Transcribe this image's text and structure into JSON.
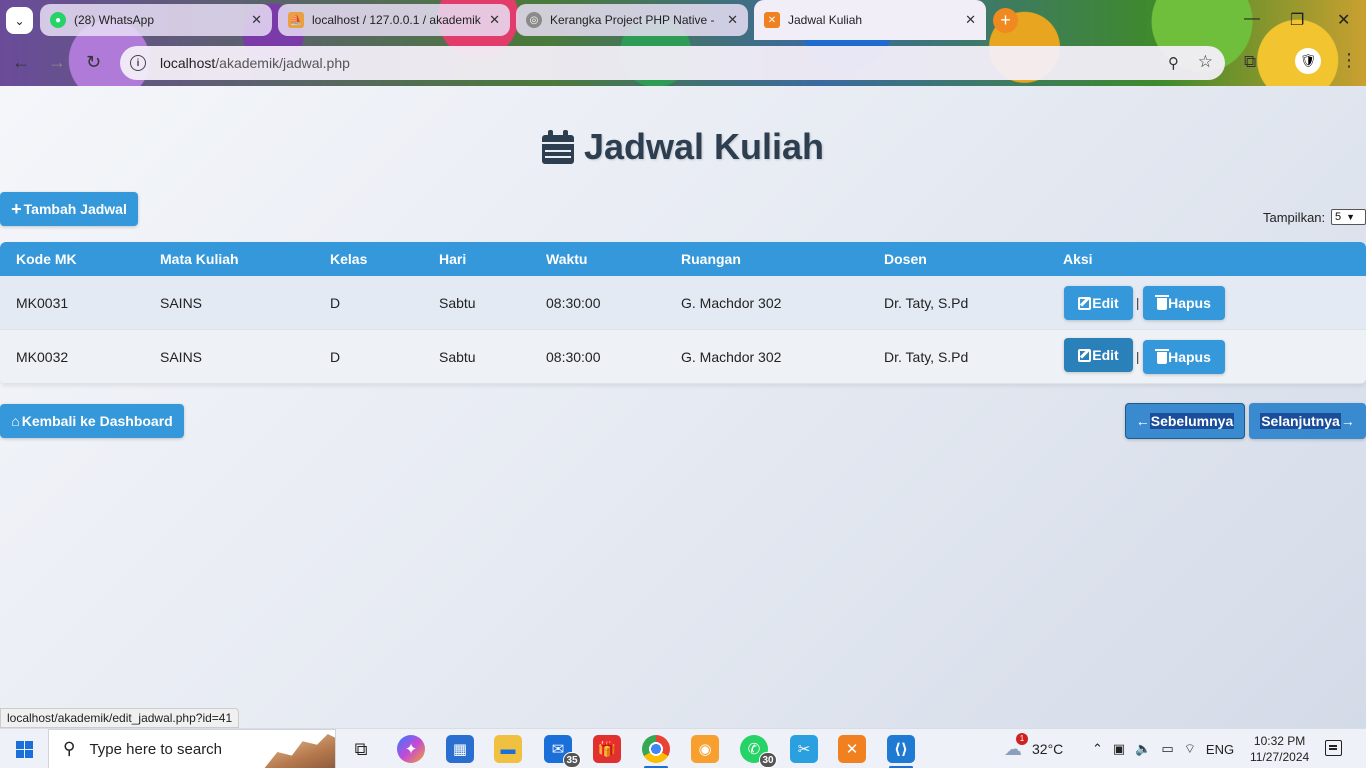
{
  "browser": {
    "tabs": [
      {
        "title": "(28) WhatsApp",
        "favicon_color": "#25d366",
        "favicon": "whatsapp-icon"
      },
      {
        "title": "localhost / 127.0.0.1 / akademik",
        "favicon_color": "#e8a040",
        "favicon": "phpmyadmin-icon"
      },
      {
        "title": "Kerangka Project PHP Native - ",
        "favicon_color": "#8a8a8a",
        "favicon": "globe-icon"
      },
      {
        "title": "Jadwal Kuliah",
        "favicon_color": "#f08020",
        "favicon": "xampp-icon"
      }
    ],
    "url_host": "localhost",
    "url_path": "/akademik/jadwal.php",
    "status_url": "localhost/akademik/edit_jadwal.php?id=41"
  },
  "page": {
    "title": "Jadwal Kuliah",
    "add_button": "Tambah Jadwal",
    "show_label": "Tampilkan:",
    "show_value": "5",
    "back_button": "Kembali ke Dashboard",
    "prev_button": "Sebelumnya",
    "next_button": "Selanjutnya",
    "accent_color": "#3498db"
  },
  "table": {
    "headers": [
      "Kode MK",
      "Mata Kuliah",
      "Kelas",
      "Hari",
      "Waktu",
      "Ruangan",
      "Dosen",
      "Aksi"
    ],
    "rows": [
      [
        "MK0031",
        "SAINS",
        "D",
        "Sabtu",
        "08:30:00",
        "G. Machdor 302",
        "Dr. Taty, S.Pd"
      ],
      [
        "MK0032",
        "SAINS",
        "D",
        "Sabtu",
        "08:30:00",
        "G. Machdor 302",
        "Dr. Taty, S.Pd"
      ]
    ],
    "edit_label": "Edit",
    "delete_label": "Hapus",
    "separator": "|"
  },
  "taskbar": {
    "search_placeholder": "Type here to search",
    "mail_badge": "35",
    "whatsapp_badge": "30",
    "weather_badge": "1",
    "temperature": "32°C",
    "language": "ENG",
    "time": "10:32 PM",
    "date": "11/27/2024"
  }
}
